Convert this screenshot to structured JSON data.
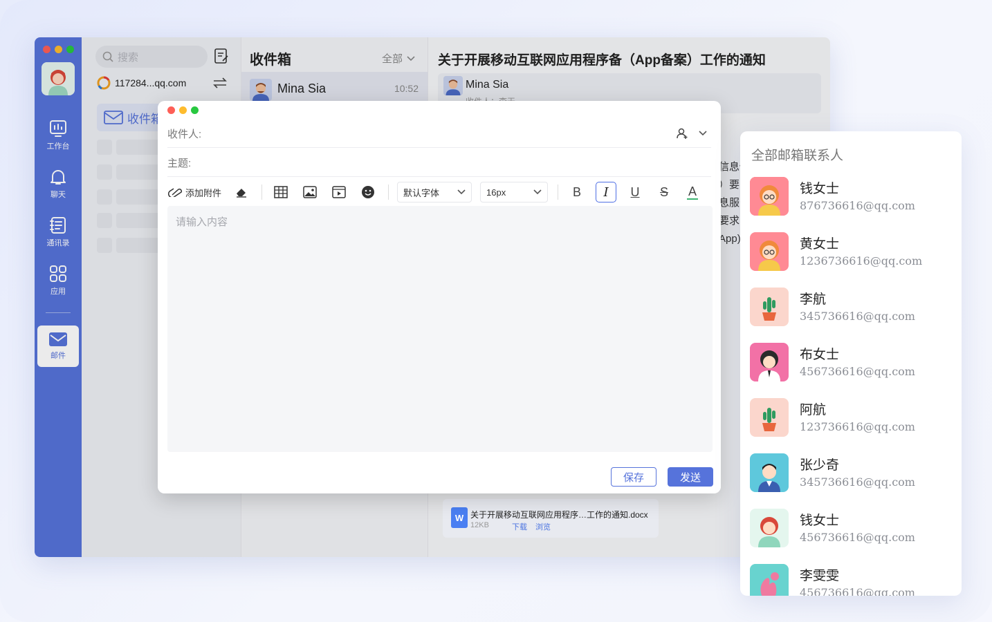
{
  "app": {
    "rail": {
      "items": [
        {
          "label": "工作台",
          "icon": "dashboard-icon"
        },
        {
          "label": "聊天",
          "icon": "bell-icon"
        },
        {
          "label": "通讯录",
          "icon": "contacts-book-icon"
        },
        {
          "label": "应用",
          "icon": "apps-grid-icon"
        },
        {
          "label": "邮件",
          "icon": "mail-icon",
          "active": true
        }
      ]
    },
    "mailbox": {
      "search_placeholder": "搜索",
      "account": "117284...qq.com",
      "inbox_label": "收件箱"
    },
    "list": {
      "title": "收件箱",
      "filter": "全部",
      "items": [
        {
          "sender": "Mina Sia",
          "time": "10:52"
        }
      ]
    },
    "detail": {
      "title": "关于开展移动互联网应用程序备（App备案）工作的通知",
      "sender": "Mina Sia",
      "recipient_line": "收件人：李天",
      "body_fragments": [
        "信息传",
        "）要",
        "息服务",
        "要求，",
        "App)工作"
      ],
      "attachment": {
        "name": "关于开展移动互联网应用程序…工作的通知.docx",
        "size": "12KB",
        "download": "下载",
        "preview": "浏览",
        "icon_letter": "W"
      }
    }
  },
  "compose": {
    "to_label": "收件人:",
    "subject_label": "主题:",
    "toolbar": {
      "attach_label": "添加附件",
      "font_value": "默认字体",
      "size_value": "16px",
      "bold": "B",
      "italic": "I",
      "underline": "U",
      "strike": "S",
      "color": "A"
    },
    "body_placeholder": "请输入内容",
    "save_label": "保存",
    "send_label": "发送"
  },
  "contacts": {
    "title": "全部邮箱联系人",
    "items": [
      {
        "name": "钱女士",
        "email": "876736616@qq.com",
        "avatar": "woman-orange-hair-glasses"
      },
      {
        "name": "黄女士",
        "email": "1236736616@qq.com",
        "avatar": "woman-orange-hair-glasses"
      },
      {
        "name": "李航",
        "email": "345736616@qq.com",
        "avatar": "cactus-plant"
      },
      {
        "name": "布女士",
        "email": "456736616@qq.com",
        "avatar": "woman-dark-hair"
      },
      {
        "name": "阿航",
        "email": "123736616@qq.com",
        "avatar": "cactus-plant"
      },
      {
        "name": "张少奇",
        "email": "345736616@qq.com",
        "avatar": "man-suit"
      },
      {
        "name": "钱女士",
        "email": "456736616@qq.com",
        "avatar": "woman-red-hair"
      },
      {
        "name": "李雯雯",
        "email": "456736616@qq.com",
        "avatar": "pink-squirrel"
      }
    ]
  },
  "colors": {
    "accent": "#5673db",
    "close": "#fe5f57",
    "minimize": "#febc2e",
    "maximize": "#28c840"
  }
}
